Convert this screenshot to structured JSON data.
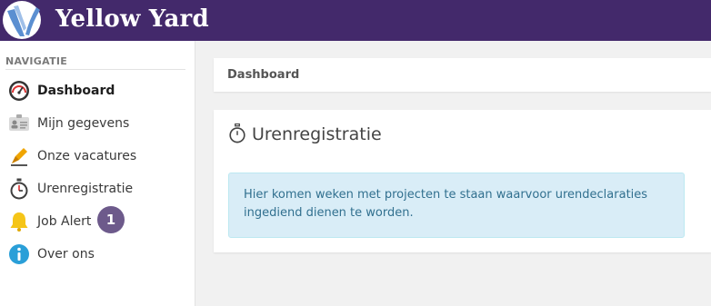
{
  "header": {
    "brand": "Yellow Yard"
  },
  "sidebar": {
    "heading": "NAVIGATIE",
    "items": [
      {
        "label": "Dashboard",
        "icon": "gauge-icon",
        "active": true
      },
      {
        "label": "Mijn gegevens",
        "icon": "id-card-icon"
      },
      {
        "label": "Onze vacatures",
        "icon": "pen-icon"
      },
      {
        "label": "Urenregistratie",
        "icon": "stopwatch-icon"
      },
      {
        "label": "Job Alert",
        "icon": "bell-icon",
        "badge": "1"
      },
      {
        "label": "Over ons",
        "icon": "info-icon"
      }
    ]
  },
  "breadcrumb": {
    "title": "Dashboard"
  },
  "panel": {
    "title": "Urenregistratie",
    "icon": "stopwatch-icon",
    "message": "Hier komen weken met projecten te staan waarvoor urendeclaraties ingediend dienen te worden."
  },
  "colors": {
    "header_bg": "#43296b",
    "badge_bg": "#6d5a8b",
    "alert_bg": "#d9edf7",
    "alert_text": "#31708f"
  }
}
